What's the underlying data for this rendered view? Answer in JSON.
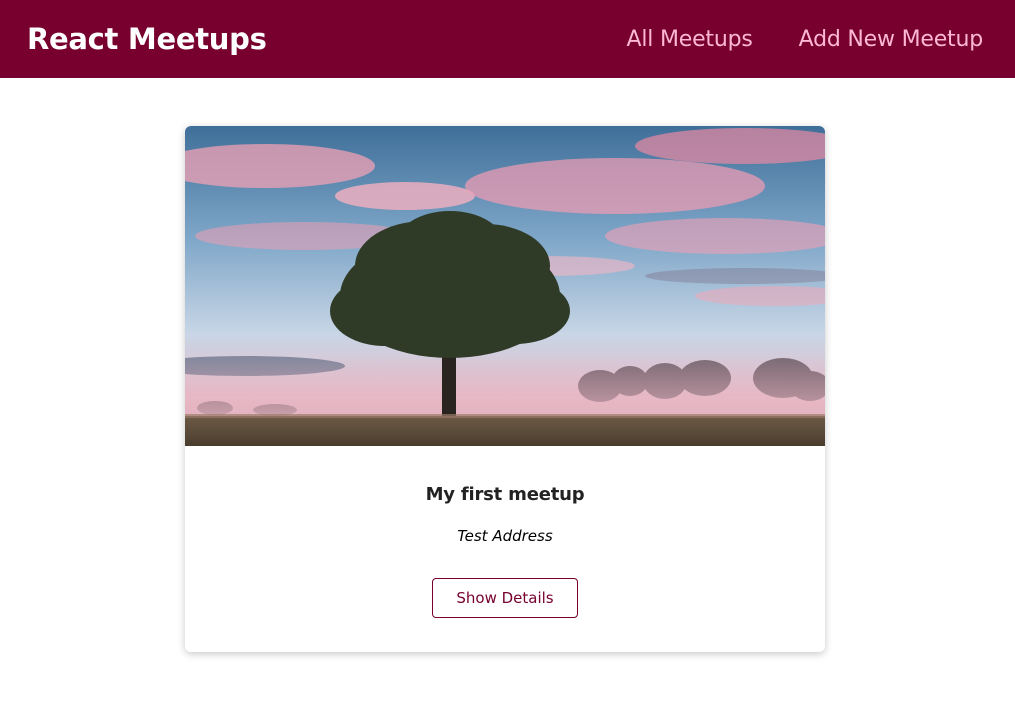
{
  "header": {
    "logo": "React Meetups",
    "nav": [
      {
        "label": "All Meetups"
      },
      {
        "label": "Add New Meetup"
      }
    ]
  },
  "meetups": [
    {
      "title": "My first meetup",
      "address": "Test Address",
      "button_label": "Show Details"
    }
  ],
  "colors": {
    "brand": "#77002e",
    "nav_link": "#fcb8d2"
  }
}
